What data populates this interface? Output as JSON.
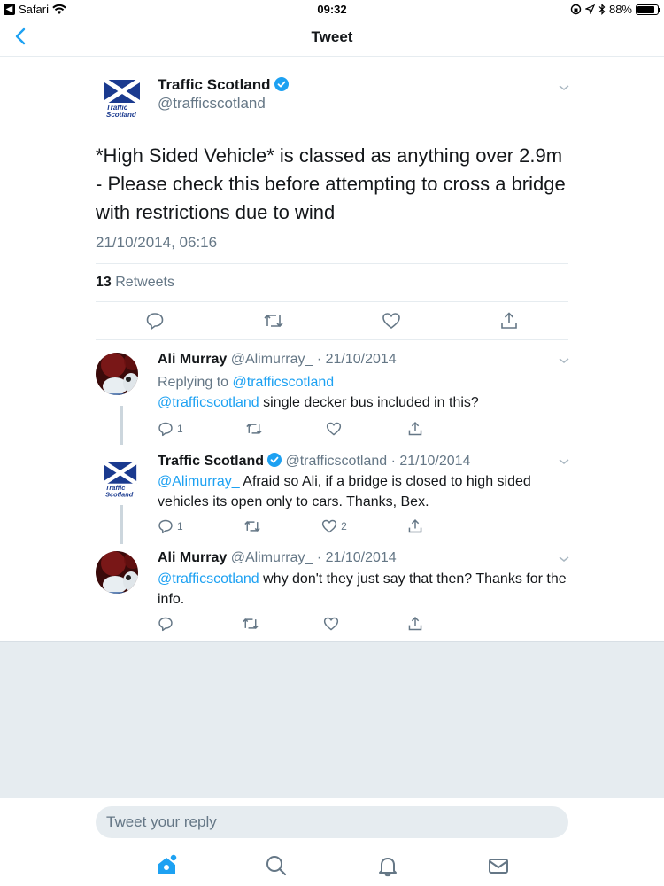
{
  "status_bar": {
    "back_app": "Safari",
    "time": "09:32",
    "battery": "88%",
    "battery_level": 0.88
  },
  "nav": {
    "title": "Tweet"
  },
  "main_tweet": {
    "author_name": "Traffic Scotland",
    "handle": "@trafficscotland",
    "avatar_text_line1": "Traffic",
    "avatar_text_line2": "Scotland",
    "text": "*High Sided Vehicle* is classed as anything over 2.9m - Please check this before attempting to cross a bridge with restrictions due to wind",
    "date": "21/10/2014, 06:16",
    "retweet_count": "13",
    "retweet_label": "Retweets"
  },
  "replies": [
    {
      "name": "Ali Murray",
      "meta": "@Alimurray_ · 21/10/2014",
      "replying_prefix": "Replying to",
      "replying_to": "@trafficscotland",
      "mention": "@trafficscotland",
      "text": " single decker bus included in this?",
      "reply_count": "1",
      "like_count": ""
    },
    {
      "name": "Traffic Scotland",
      "meta": "@trafficscotland · 21/10/2014",
      "mention": "@Alimurray_",
      "text": " Afraid so Ali, if a bridge is closed to high sided vehicles its open only to cars. Thanks, Bex.",
      "reply_count": "1",
      "like_count": "2"
    },
    {
      "name": "Ali Murray",
      "meta": "@Alimurray_ · 21/10/2014",
      "mention": "@trafficscotland",
      "text": " why don't they just say that then? Thanks for the info.",
      "reply_count": "",
      "like_count": ""
    }
  ],
  "compose": {
    "placeholder": "Tweet your reply"
  },
  "colors": {
    "accent": "#1da1f2",
    "secondary_text": "#657786",
    "divider": "#e6ecf0"
  }
}
